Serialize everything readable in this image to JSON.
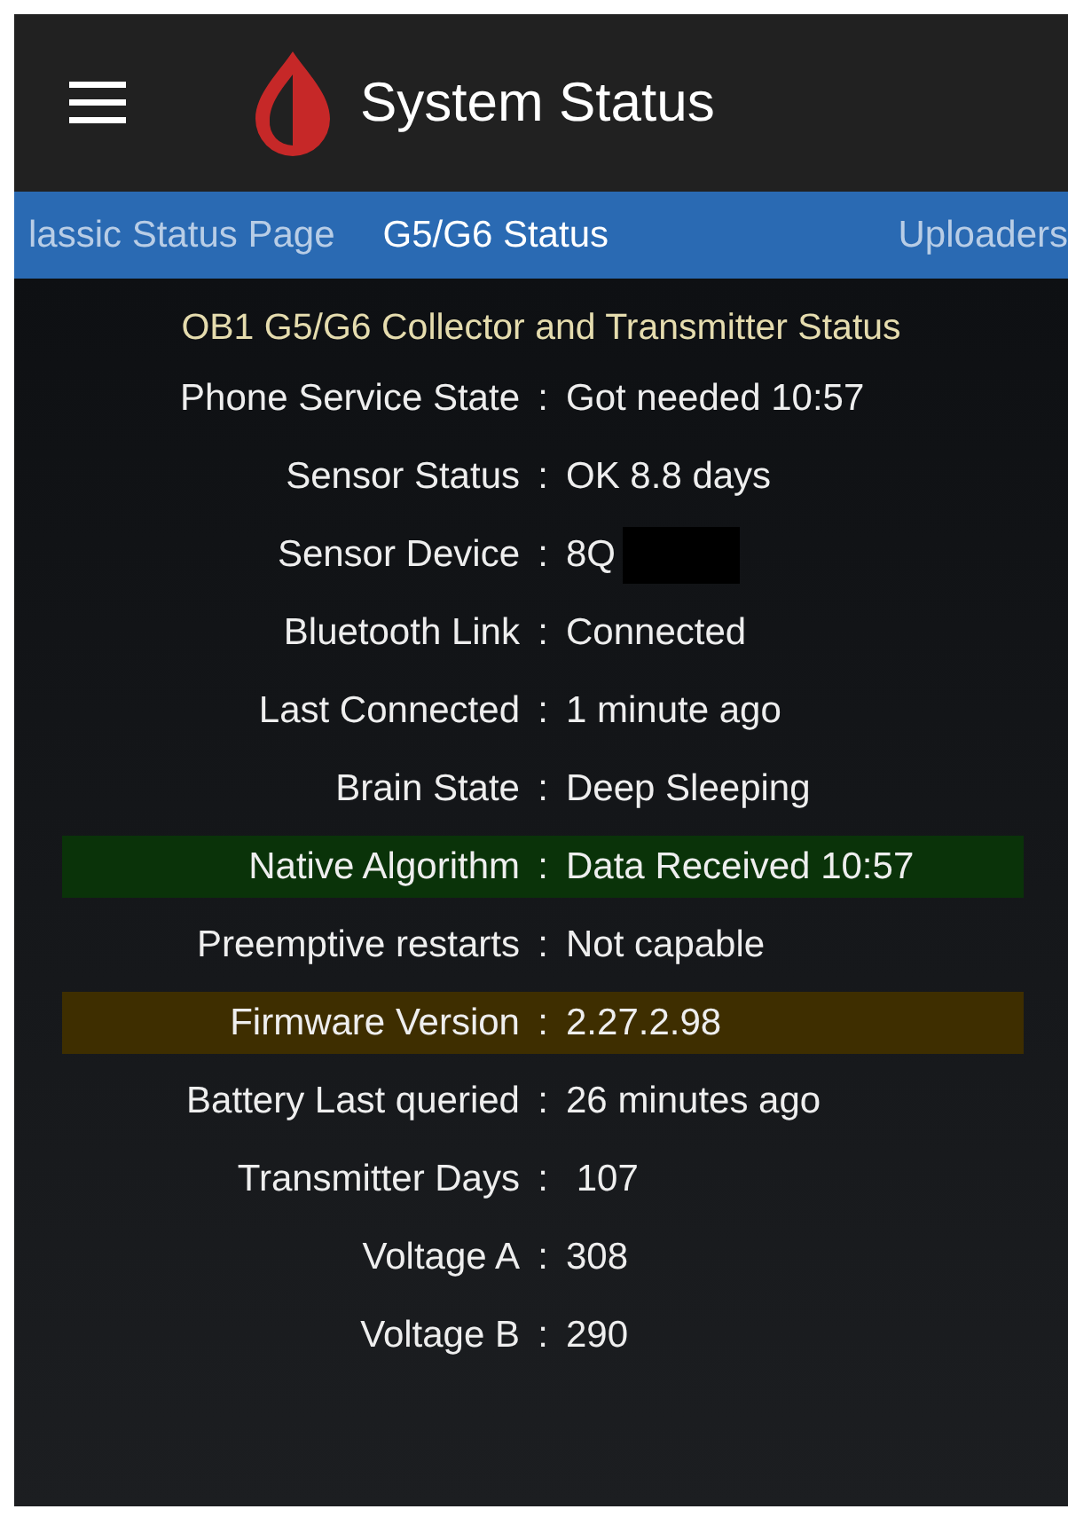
{
  "app_bar": {
    "title": "System Status"
  },
  "tabs": [
    {
      "label": "lassic Status Page",
      "selected": false
    },
    {
      "label": "G5/G6 Status",
      "selected": true
    },
    {
      "label": "Uploaders",
      "selected": false
    }
  ],
  "heading": "OB1 G5/G6 Collector and Transmitter Status",
  "separator": ":",
  "rows": [
    {
      "label": "Phone Service State",
      "value": "Got needed 10:57"
    },
    {
      "label": "Sensor Status",
      "value": "OK 8.8 days"
    },
    {
      "label": "Sensor Device",
      "value": "8Q",
      "redacted": true
    },
    {
      "label": "Bluetooth Link",
      "value": "Connected"
    },
    {
      "label": "Last Connected",
      "value": "1 minute ago"
    },
    {
      "label": "Brain State",
      "value": "Deep Sleeping"
    },
    {
      "label": "Native Algorithm",
      "value": "Data Received 10:57",
      "color": "#0a3309"
    },
    {
      "label": "Preemptive restarts",
      "value": "Not capable"
    },
    {
      "label": "Firmware Version",
      "value": "2.27.2.98",
      "color": "#3e2e00"
    },
    {
      "label": "Battery Last queried",
      "value": "26 minutes ago"
    },
    {
      "label": "Transmitter Days",
      "value": " 107"
    },
    {
      "label": "Voltage A",
      "value": "308"
    },
    {
      "label": "Voltage B",
      "value": "290"
    }
  ]
}
